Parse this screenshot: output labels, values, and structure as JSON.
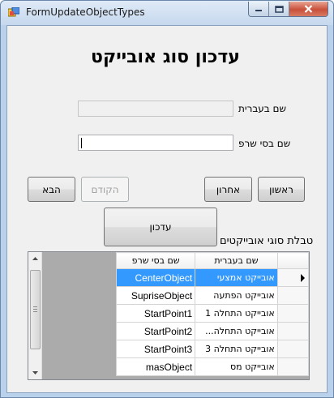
{
  "window": {
    "title": "FormUpdateObjectTypes"
  },
  "form": {
    "heading": "עדכון סוג אובייקט",
    "hebrew_name_label": "שם בעברית",
    "hebrew_name_value": "",
    "sharp_name_label": "שם בסי שרפ",
    "sharp_name_value": ""
  },
  "nav": {
    "first_label": "ראשון",
    "last_label": "אחרון",
    "previous_label": "הקודם",
    "next_label": "הבא",
    "update_label": "עדכון"
  },
  "grid": {
    "caption": "טבלת סוגי אובייקטים",
    "columns": [
      "שם בעברית",
      "שם בסי שרפ"
    ],
    "selected_row_index": 0,
    "rows": [
      {
        "hebrew": "אובייקט אמצעי",
        "sharp": "CenterObject"
      },
      {
        "hebrew": "אובייקט הפתעה",
        "sharp": "SupriseObject"
      },
      {
        "hebrew": "אובייקט התחלה 1",
        "sharp": "StartPoint1"
      },
      {
        "hebrew": "אובייקט התחלה...",
        "sharp": "StartPoint2"
      },
      {
        "hebrew": "אובייקט התחלה 3",
        "sharp": "StartPoint3"
      },
      {
        "hebrew": "אובייקט מס",
        "sharp": "masObject"
      }
    ]
  },
  "colors": {
    "selection": "#3399ff",
    "frame": "#b9d1ea",
    "client": "#f0f0f0"
  }
}
